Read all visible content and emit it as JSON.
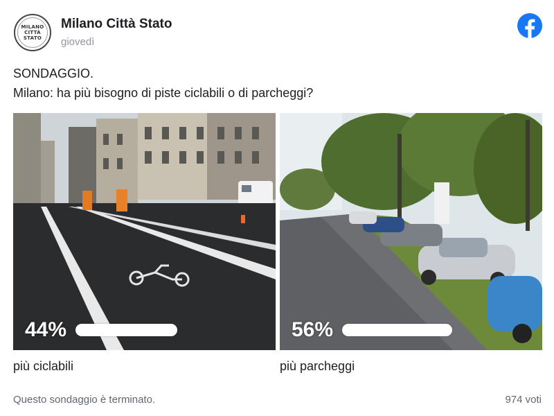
{
  "post": {
    "page_name": "Milano Città Stato",
    "time": "giovedì",
    "avatar_text": [
      "MILANO",
      "CITTÀ",
      "STATO"
    ],
    "message_line1": "SONDAGGIO.",
    "message_line2": "Milano: ha più bisogno di piste ciclabili o di parcheggi?"
  },
  "poll": {
    "options": [
      {
        "label": "più ciclabili",
        "percent_text": "44%",
        "percent": 44
      },
      {
        "label": "più parcheggi",
        "percent_text": "56%",
        "percent": 56
      }
    ],
    "status": "Questo sondaggio è terminato.",
    "votes": "974 voti"
  },
  "colors": {
    "facebook_blue": "#1877f2",
    "text": "#1c1e21",
    "muted": "#606770"
  },
  "icons": {
    "brand": "facebook-icon"
  }
}
